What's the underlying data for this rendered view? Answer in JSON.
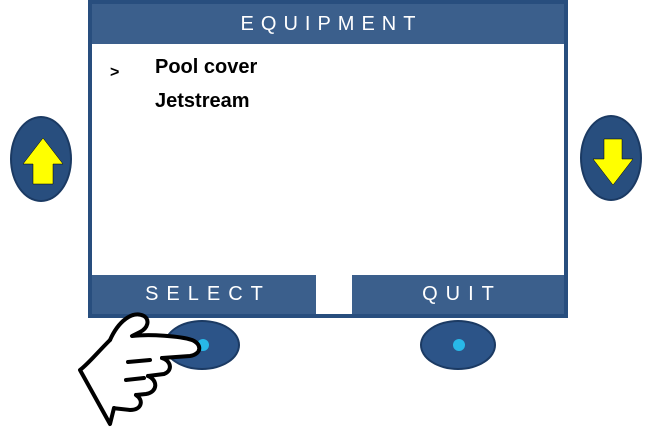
{
  "screen": {
    "title": "EQUIPMENT",
    "menu": [
      {
        "cursor": ">",
        "label": "Pool cover",
        "selected": true
      },
      {
        "cursor": "",
        "label": "Jetstream",
        "selected": false
      }
    ],
    "softkeys": {
      "left_label": "SELECT",
      "right_label": "QUIT"
    }
  },
  "controls": {
    "up_button_icon": "arrow-up-icon",
    "down_button_icon": "arrow-down-icon",
    "pointer_icon": "pointing-hand-icon"
  },
  "colors": {
    "panel_blue": "#3b5f8c",
    "frame_blue": "#284e7e",
    "arrow_yellow": "#ffff00",
    "button_dot": "#28b8e8"
  }
}
